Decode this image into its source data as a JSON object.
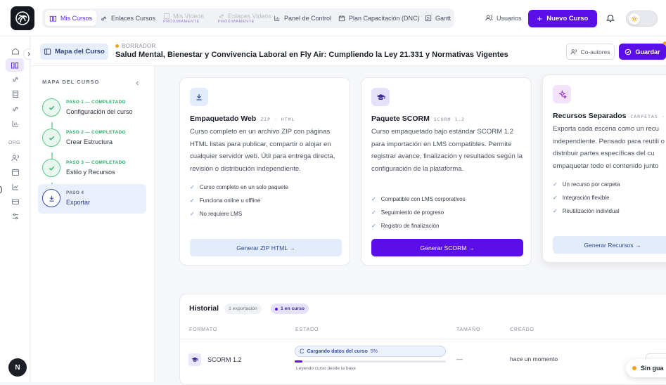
{
  "nav": {
    "items": [
      {
        "label": "Mis Cursos",
        "icon": "book-icon",
        "active": true
      },
      {
        "label": "Enlaces Cursos",
        "icon": "link-icon"
      },
      {
        "label": "Mis Videos",
        "icon": "film-icon",
        "disabled": true,
        "sub": "PRÓXIMAMENTE"
      },
      {
        "label": "Enlaces Videos",
        "icon": "link-icon",
        "disabled": true,
        "sub": "PRÓXIMAMENTE"
      },
      {
        "label": "Panel de Control",
        "icon": "bar-chart-icon"
      },
      {
        "label": "Plan Capacitación (DNC)",
        "icon": "calendar-icon"
      },
      {
        "label": "Gantt",
        "icon": "gantt-icon"
      }
    ],
    "usuarios": "Usuarios",
    "nuevo_curso": "Nuevo Curso"
  },
  "rail": {
    "org_label": "ORG",
    "avatar_initial": "N"
  },
  "course": {
    "map_button": "Mapa del Curso",
    "status": "BORRADOR",
    "title": "Salud Mental, Bienestar y Convivencia Laboral en Fly Air: Cumpliendo la Ley 21.331 y Normativas Vigentes",
    "coauthors": "Co-autores",
    "save": "Guardar"
  },
  "stepper": {
    "title": "MAPA DEL CURSO",
    "steps": [
      {
        "label": "PASO 1 — COMPLETADO",
        "name": "Configuración del curso"
      },
      {
        "label": "PASO 2 — COMPLETADO",
        "name": "Crear Estructura"
      },
      {
        "label": "PASO 3 — COMPLETADO",
        "name": "Estilo y Recursos"
      },
      {
        "label": "PASO 4",
        "name": "Exportar"
      }
    ]
  },
  "cards": [
    {
      "title": "Empaquetado Web",
      "tag": "ZIP · HTML",
      "desc": "Curso completo en un archivo ZIP con páginas HTML listas para publicar, compartir o alojar en cualquier servidor web. Útil para entrega directa, revisión o distribución independiente.",
      "features": [
        "Curso completo en un solo paquete",
        "Funciona online u offline",
        "No requiere LMS"
      ],
      "button": "Generar ZIP HTML →"
    },
    {
      "title": "Paquete SCORM",
      "tag": "SCORM 1.2",
      "desc": "Curso empaquetado bajo estándar SCORM 1.2 para importación en LMS compatibles. Permite registrar avance, finalización y resultados según la configuración de la plataforma.",
      "features": [
        "Compatible con LMS corporativos",
        "Seguimiento de progreso",
        "Registro de finalización"
      ],
      "button": "Generar SCORM →"
    },
    {
      "title": "Recursos Separados",
      "tag": "CARPETAS · I",
      "desc": "Exporta cada escena como un recu independiente. Pensado para reutili o distribuir partes específicas del cu empaquetar todo el contenido junto",
      "features": [
        "Un recurso por carpeta",
        "Integración flexible",
        "Reutilización individual"
      ],
      "button": "Generar Recursos →"
    }
  ],
  "history": {
    "title": "Historial",
    "count_badge": "1 exportación",
    "running_badge": "1 en curso",
    "columns": [
      "FORMATO",
      "ESTADO",
      "TAMAÑO",
      "CREADO"
    ],
    "row": {
      "format": "SCORM 1.2",
      "status": "Cargando datos del curso",
      "percent": "5%",
      "progress": 0.05,
      "substatus": "Leyendo curso desde la base",
      "size": "—",
      "created": "hace un momento"
    }
  },
  "toast": "Sin gua",
  "colors": {
    "accent": "#5b0fe8",
    "success": "#27b065",
    "warning": "#f2a31b"
  }
}
